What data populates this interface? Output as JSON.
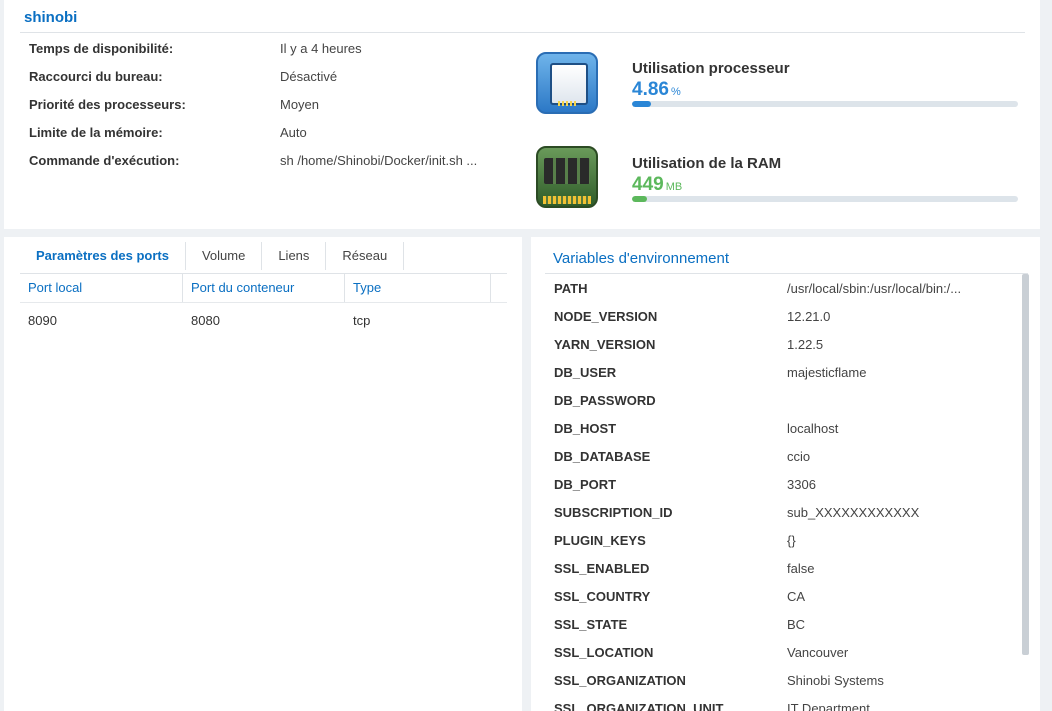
{
  "header": {
    "title": "shinobi"
  },
  "info": [
    {
      "label": "Temps de disponibilité:",
      "value": "Il y a 4 heures"
    },
    {
      "label": "Raccourci du bureau:",
      "value": "Désactivé"
    },
    {
      "label": "Priorité des processeurs:",
      "value": "Moyen"
    },
    {
      "label": "Limite de la mémoire:",
      "value": "Auto"
    },
    {
      "label": "Commande d'exécution:",
      "value": "sh /home/Shinobi/Docker/init.sh ..."
    }
  ],
  "cpu": {
    "label": "Utilisation processeur",
    "value": "4.86",
    "unit": "%",
    "fraction": 0.0486,
    "color": "#2a86d6"
  },
  "ram": {
    "label": "Utilisation de la RAM",
    "value": "449",
    "unit": "MB",
    "fraction": 0.04,
    "color": "#5cb85c"
  },
  "tabs": [
    "Paramètres des ports",
    "Volume",
    "Liens",
    "Réseau"
  ],
  "ports": {
    "headers": [
      "Port local",
      "Port du conteneur",
      "Type"
    ],
    "rows": [
      [
        "8090",
        "8080",
        "tcp"
      ]
    ]
  },
  "env": {
    "title": "Variables d'environnement",
    "vars": [
      {
        "key": "PATH",
        "value": "/usr/local/sbin:/usr/local/bin:/..."
      },
      {
        "key": "NODE_VERSION",
        "value": "12.21.0"
      },
      {
        "key": "YARN_VERSION",
        "value": "1.22.5"
      },
      {
        "key": "DB_USER",
        "value": "majesticflame"
      },
      {
        "key": "DB_PASSWORD",
        "value": ""
      },
      {
        "key": "DB_HOST",
        "value": "localhost"
      },
      {
        "key": "DB_DATABASE",
        "value": "ccio"
      },
      {
        "key": "DB_PORT",
        "value": "3306"
      },
      {
        "key": "SUBSCRIPTION_ID",
        "value": "sub_XXXXXXXXXXXX"
      },
      {
        "key": "PLUGIN_KEYS",
        "value": "{}"
      },
      {
        "key": "SSL_ENABLED",
        "value": "false"
      },
      {
        "key": "SSL_COUNTRY",
        "value": "CA"
      },
      {
        "key": "SSL_STATE",
        "value": "BC"
      },
      {
        "key": "SSL_LOCATION",
        "value": "Vancouver"
      },
      {
        "key": "SSL_ORGANIZATION",
        "value": "Shinobi Systems"
      },
      {
        "key": "SSL_ORGANIZATION_UNIT",
        "value": "IT Department"
      }
    ]
  }
}
